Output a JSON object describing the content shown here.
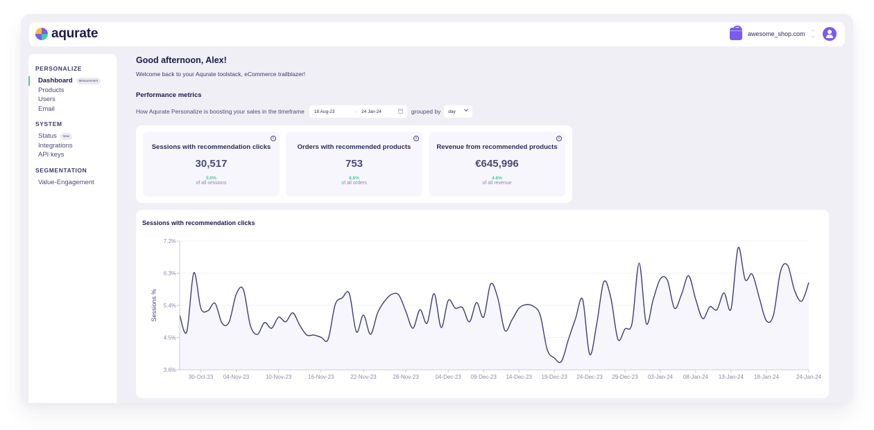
{
  "brand": {
    "name": "aqurate"
  },
  "header": {
    "shop_name": "awesome_shop.com",
    "shop_switch_icon": "chevron-up-down-icon",
    "avatar_icon": "user-icon"
  },
  "sidebar": {
    "sections": [
      {
        "title": "PERSONALIZE",
        "items": [
          {
            "label": "Dashboard",
            "badge": "Measurement",
            "active": true
          },
          {
            "label": "Products"
          },
          {
            "label": "Users"
          },
          {
            "label": "Email"
          }
        ]
      },
      {
        "title": "SYSTEM",
        "items": [
          {
            "label": "Status",
            "badge": "New"
          },
          {
            "label": "Integrations"
          },
          {
            "label": "API keys"
          }
        ]
      },
      {
        "title": "SEGMENTATION",
        "items": [
          {
            "label": "Value-Engagement"
          }
        ]
      }
    ]
  },
  "main": {
    "greeting": "Good afternoon, Alex!",
    "welcome": "Welcome back to your Aqurate toolstack, eCommerce trailblazer!",
    "section_title": "Performance metrics",
    "filter": {
      "prefix": "How Aqurate Personalize is boosting your sales in the timeframe",
      "date_from": "18 Aug-23",
      "date_to": "24 Jan-24",
      "arrow": "→",
      "grouped_by_label": "grouped by",
      "group_value": "day"
    },
    "kpis": [
      {
        "title": "Sessions with recommendation clicks",
        "value": "30,517",
        "pct": "5.0%",
        "sub": "of all sessions"
      },
      {
        "title": "Orders with recommended products",
        "value": "753",
        "pct": "8.6%",
        "sub": "of all orders"
      },
      {
        "title": "Revenue from recommended products",
        "value": "€645,996",
        "pct": "4.6%",
        "sub": "of all revenue"
      }
    ]
  },
  "colors": {
    "accent": "#7a5bf0",
    "positive": "#3fd19c",
    "line": "#3b3a7a",
    "area": "#f7f6fd"
  },
  "chart_data": {
    "type": "line",
    "title": "Sessions with recommendation clicks",
    "xlabel": "",
    "ylabel": "Sessions %",
    "ylim": [
      3.6,
      7.2
    ],
    "yticks": [
      3.6,
      4.5,
      5.4,
      6.3,
      7.2
    ],
    "ytick_labels": [
      "3.6%",
      "4.5%",
      "5.4%",
      "6.3%",
      "7.2%"
    ],
    "xtick_labels": [
      "30-Oct-23",
      "04-Nov-23",
      "10-Nov-23",
      "16-Nov-23",
      "22-Nov-23",
      "28-Nov-23",
      "04-Dec-23",
      "09-Dec-23",
      "14-Dec-23",
      "19-Dec-23",
      "24-Dec-23",
      "29-Dec-23",
      "03-Jan-24",
      "08-Jan-24",
      "13-Jan-24",
      "18-Jan-24",
      "24-Jan-24"
    ],
    "xtick_day_index": [
      3,
      8,
      14,
      20,
      26,
      32,
      38,
      43,
      48,
      53,
      58,
      63,
      68,
      73,
      78,
      83,
      89
    ],
    "x_start": "27-Oct-23",
    "x_end": "24-Jan-24",
    "grid": true,
    "series": [
      {
        "name": "Sessions %",
        "values": [
          5.13,
          4.66,
          6.31,
          5.32,
          5.25,
          5.46,
          4.9,
          4.94,
          5.71,
          5.85,
          4.84,
          4.59,
          4.92,
          4.76,
          5.07,
          4.94,
          5.19,
          4.84,
          4.57,
          4.57,
          4.51,
          4.45,
          5.42,
          5.61,
          5.73,
          4.66,
          5.13,
          4.59,
          5.19,
          5.52,
          5.71,
          5.69,
          5.23,
          4.76,
          5.28,
          4.9,
          5.73,
          4.78,
          5.54,
          5.32,
          5.34,
          4.94,
          5.48,
          5.07,
          6.0,
          5.61,
          4.7,
          4.99,
          5.32,
          5.42,
          5.38,
          5.13,
          4.16,
          3.93,
          3.83,
          4.45,
          5.03,
          5.57,
          4.03,
          4.88,
          6.06,
          5.61,
          4.45,
          4.74,
          4.9,
          6.58,
          4.9,
          5.57,
          6.14,
          6.1,
          5.32,
          5.71,
          6.23,
          5.57,
          5.03,
          5.36,
          5.28,
          5.75,
          5.3,
          7.01,
          6.12,
          6.27,
          5.61,
          4.97,
          5.13,
          6.35,
          6.52,
          5.81,
          5.52,
          6.04
        ]
      }
    ]
  }
}
